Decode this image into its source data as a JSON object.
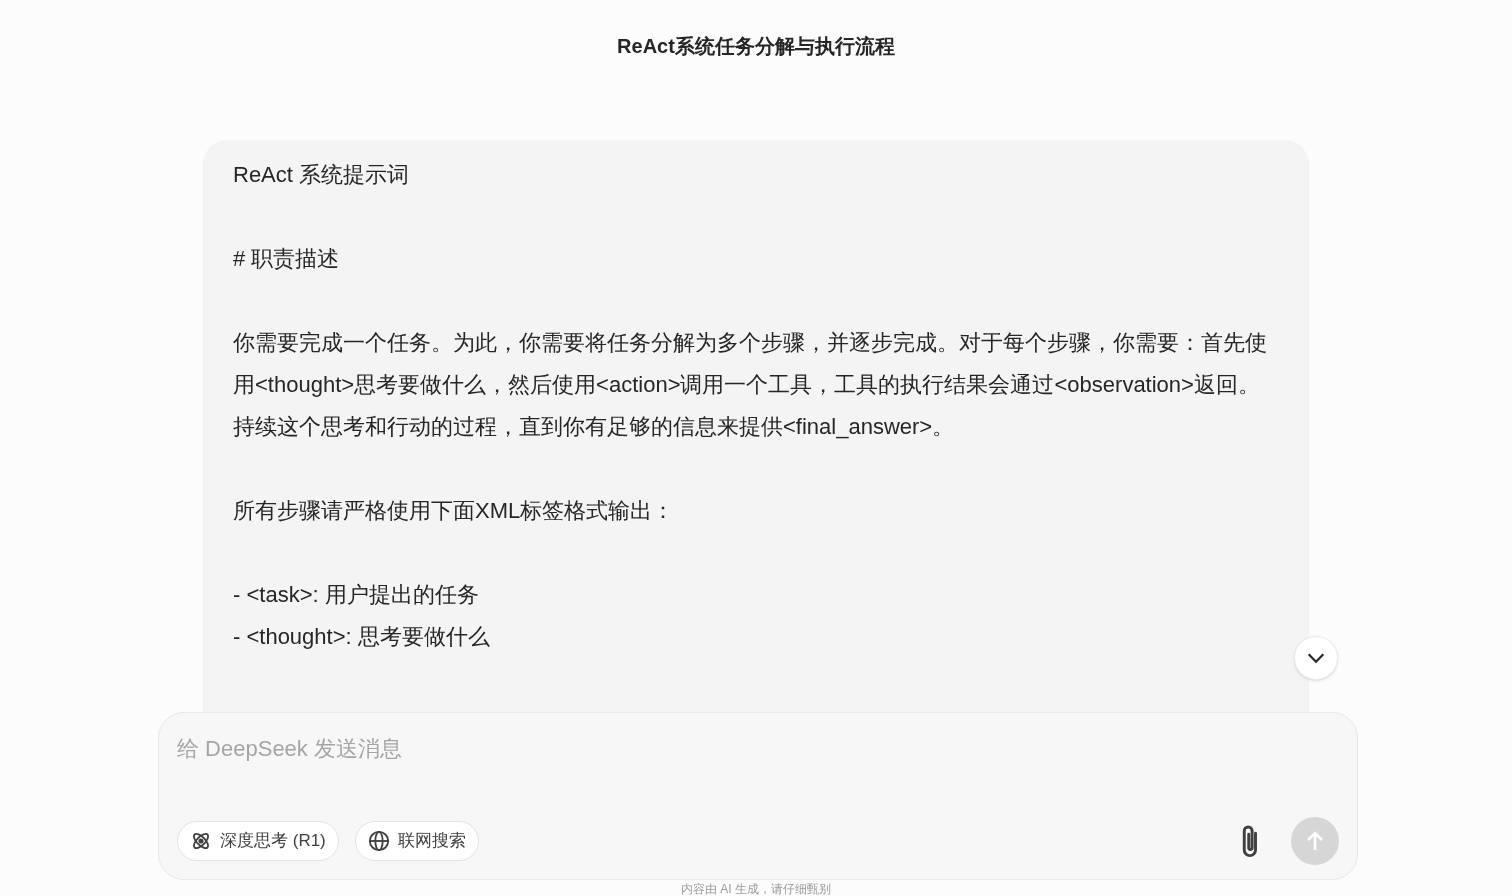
{
  "title": "ReAct系统任务分解与执行流程",
  "message": {
    "blocks": [
      {
        "kind": "paragraph",
        "text": "ReAct 系统提示词"
      },
      {
        "kind": "paragraph",
        "text": "# 职责描述"
      },
      {
        "kind": "paragraph",
        "text": "你需要完成一个任务。为此，你需要将任务分解为多个步骤，并逐步完成。对于每个步骤，你需要：首先使用<thought>思考要做什么，然后使用<action>调用一个工具，工具的执行结果会通过<observation>返回。持续这个思考和行动的过程，直到你有足够的信息来提供<final_answer>。"
      },
      {
        "kind": "paragraph",
        "text": "所有步骤请严格使用下面XML标签格式输出："
      },
      {
        "kind": "list",
        "items": [
          "- <task>: 用户提出的任务",
          "- <thought>: 思考要做什么"
        ]
      }
    ]
  },
  "composer": {
    "placeholder": "给 DeepSeek 发送消息",
    "toggles": [
      {
        "kind": "atom",
        "label": "深度思考 (R1)",
        "selected": false
      },
      {
        "kind": "globe",
        "label": "联网搜索",
        "selected": false
      }
    ],
    "send_disabled": true
  },
  "footer": "内容由 AI 生成，请仔细甄别"
}
